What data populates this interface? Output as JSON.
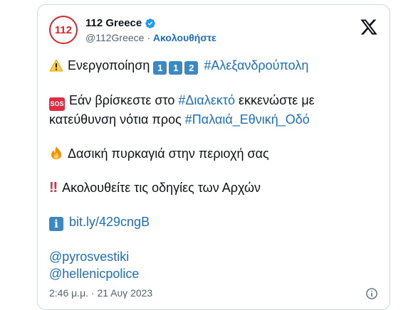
{
  "tweet": {
    "display_name": "112 Greece",
    "handle": "@112Greece",
    "separator": "·",
    "follow_label": "Ακολουθήστε",
    "avatar_text": "112",
    "lines": {
      "activation_text": "Ενεργοποίηση",
      "keycap_1a": "1",
      "keycap_1b": "1",
      "keycap_2": "2",
      "hashtag_city": "#Αλεξανδρούπολη",
      "sos_label": "SOS",
      "evac_text_1": "Εάν βρίσκεστε στο",
      "hashtag_area": "#Διαλεκτό",
      "evac_text_2": "εκκενώστε με",
      "evac_text_3": "κατεύθυνση νότια προς",
      "hashtag_road": "#Παλαιά_Εθνική_Οδό",
      "fire_text": "Δασική πυρκαγιά στην περιοχή σας",
      "follow_text": "Ακολουθείτε τις οδηγίες των Αρχών",
      "info_glyph": "i",
      "link": "bit.ly/429cngB",
      "mention_1": "@pyrosvestiki",
      "mention_2": "@hellenicpolice"
    },
    "timestamp": "2:46 μ.μ. · 21 Αυγ 2023"
  },
  "colors": {
    "link": "#1d6fbd",
    "text": "#0f1419",
    "muted": "#536471",
    "border": "#cfd9de",
    "sos": "#dd2e44",
    "keycap": "#3b88c3"
  },
  "icons": [
    "verified-badge-icon",
    "x-logo-icon",
    "warning-icon",
    "sos-icon",
    "fire-icon",
    "double-exclamation-icon",
    "information-icon",
    "info-circle-icon"
  ]
}
